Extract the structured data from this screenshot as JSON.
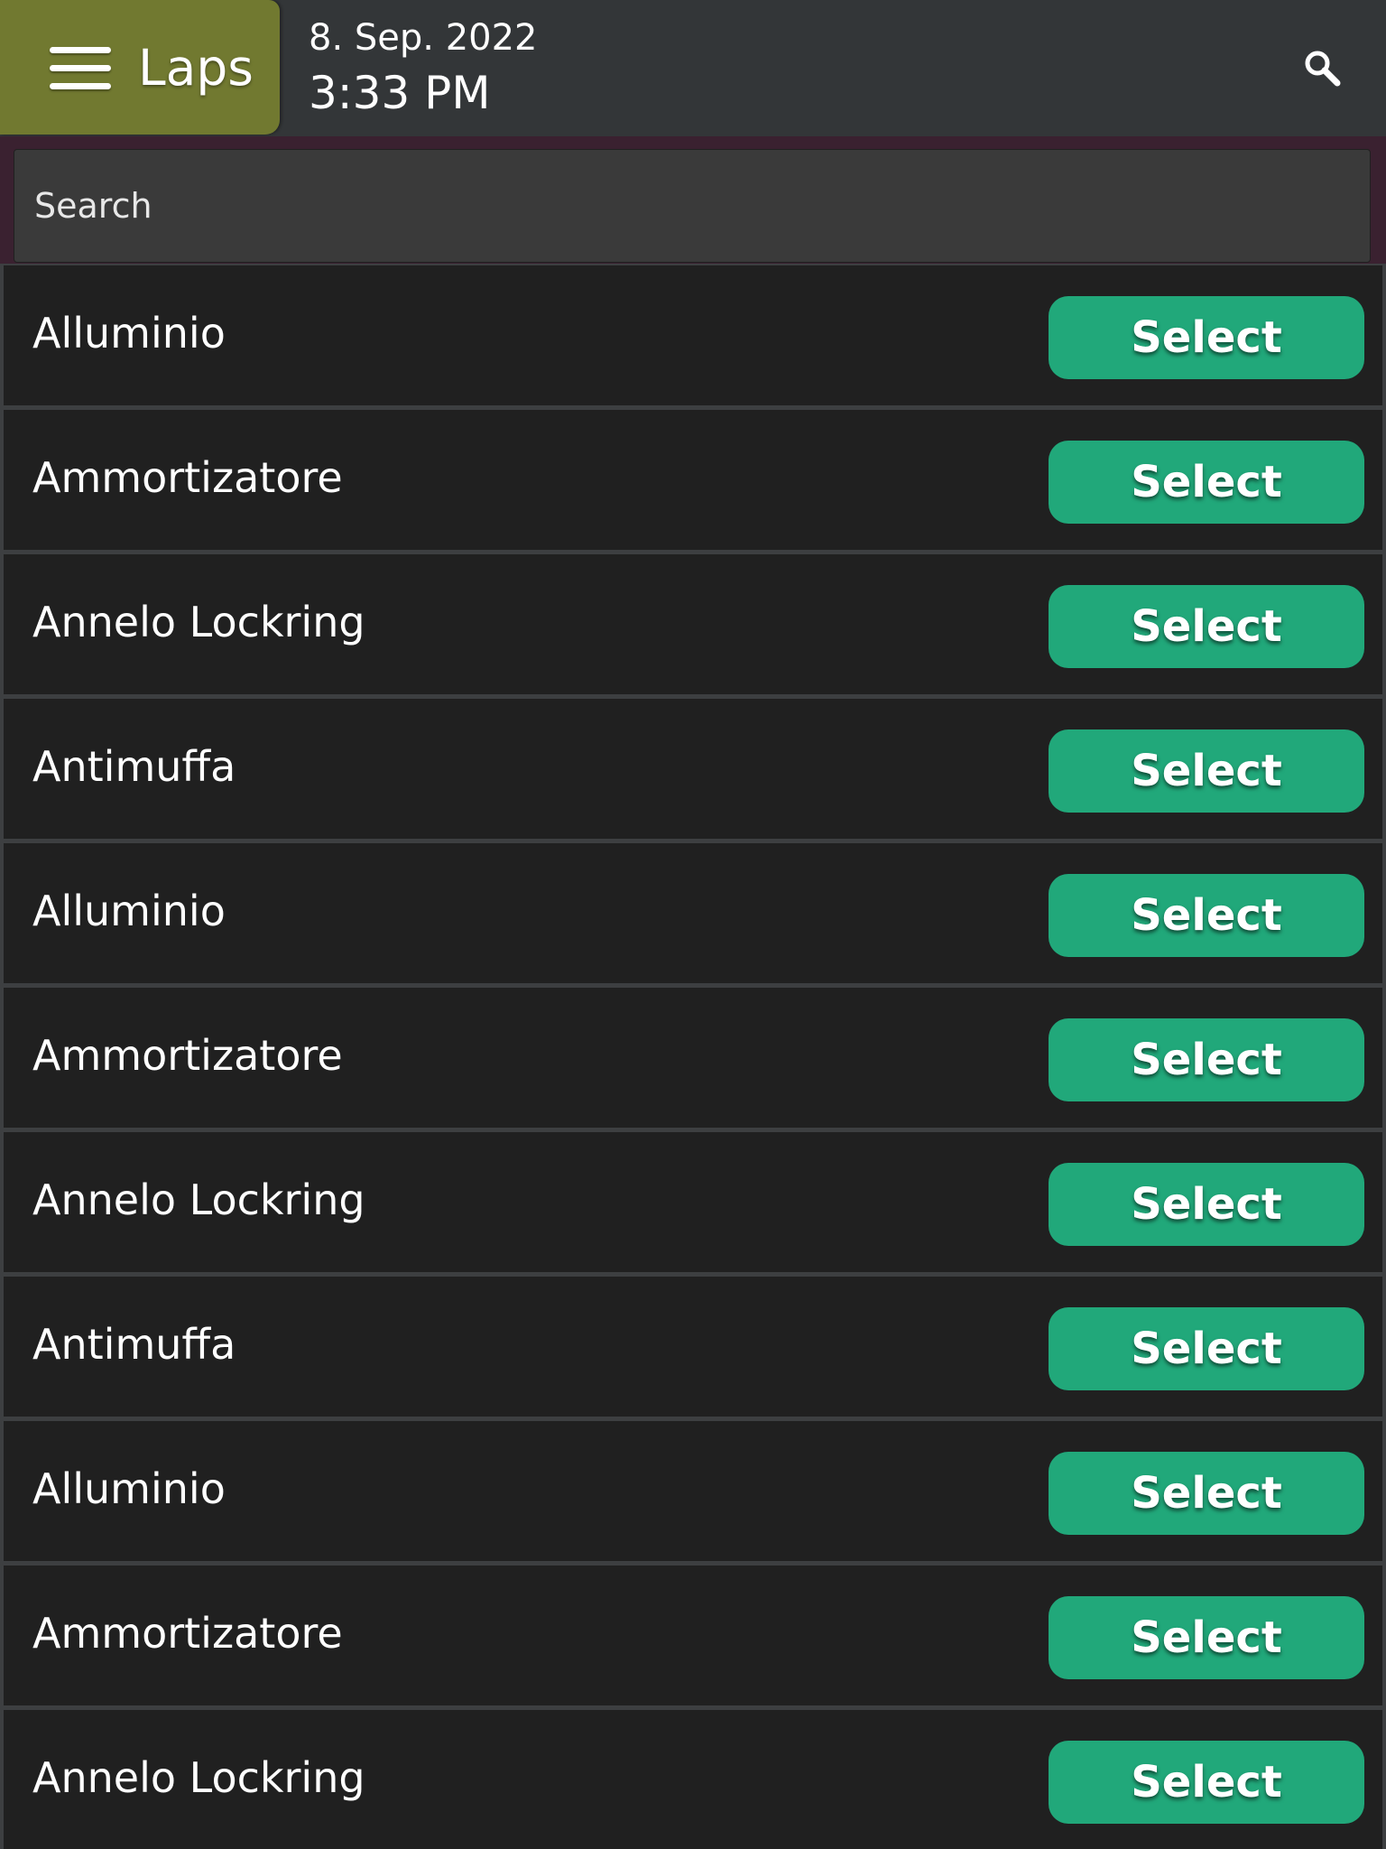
{
  "header": {
    "menu_title": "Laps",
    "date": "8. Sep. 2022",
    "time": "3:33 PM",
    "menu_icon": "hamburger-icon",
    "search_icon": "search-icon",
    "menu_color": "#717930",
    "bar_color": "#333638"
  },
  "search": {
    "placeholder": "Search",
    "value": ""
  },
  "list": {
    "button_color": "#21a87a",
    "items": [
      {
        "label": "Alluminio",
        "button": "Select"
      },
      {
        "label": "Ammortizatore",
        "button": "Select"
      },
      {
        "label": "Annelo Lockring",
        "button": "Select"
      },
      {
        "label": "Antimuffa",
        "button": "Select"
      },
      {
        "label": "Alluminio",
        "button": "Select"
      },
      {
        "label": "Ammortizatore",
        "button": "Select"
      },
      {
        "label": "Annelo Lockring",
        "button": "Select"
      },
      {
        "label": "Antimuffa",
        "button": "Select"
      },
      {
        "label": "Alluminio",
        "button": "Select"
      },
      {
        "label": "Ammortizatore",
        "button": "Select"
      },
      {
        "label": "Annelo Lockring",
        "button": "Select"
      }
    ]
  }
}
